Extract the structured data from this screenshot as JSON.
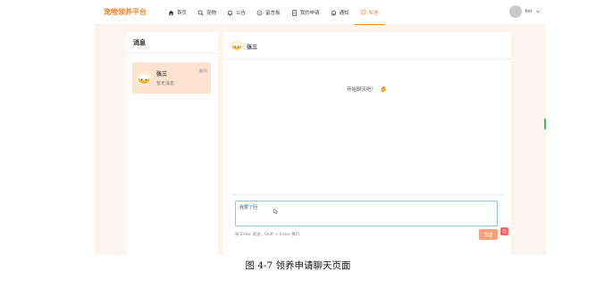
{
  "app": {
    "brand": "宠物领养平台",
    "nav": [
      {
        "label": "首页",
        "icon": "home-icon"
      },
      {
        "label": "宠物",
        "icon": "search-icon"
      },
      {
        "label": "公告",
        "icon": "bell-icon"
      },
      {
        "label": "留言板",
        "icon": "chat-bubble-icon"
      },
      {
        "label": "我的申请",
        "icon": "document-icon"
      },
      {
        "label": "通知",
        "icon": "bell-icon"
      },
      {
        "label": "私信",
        "icon": "message-icon"
      }
    ],
    "active_nav_index": 6,
    "user": {
      "name": "lisi"
    }
  },
  "sidebar": {
    "title": "消息",
    "conversations": [
      {
        "name": "张三",
        "preview": "暂无消息",
        "delete_label": "删除"
      }
    ]
  },
  "chat": {
    "contact_name": "张三",
    "hint": "开始聊天吧！",
    "input_value": "我要了回",
    "tip": "按 Enter 发送，Shift + Enter 换行",
    "send_label": "发送"
  },
  "badge": {
    "label": "Q"
  },
  "caption": "图 4-7  领养申请聊天页面",
  "colors": {
    "accent": "#f0882f",
    "active_conversation": "#fde2d2",
    "send_button": "#f4a27a",
    "input_border": "#8ec1ea"
  }
}
